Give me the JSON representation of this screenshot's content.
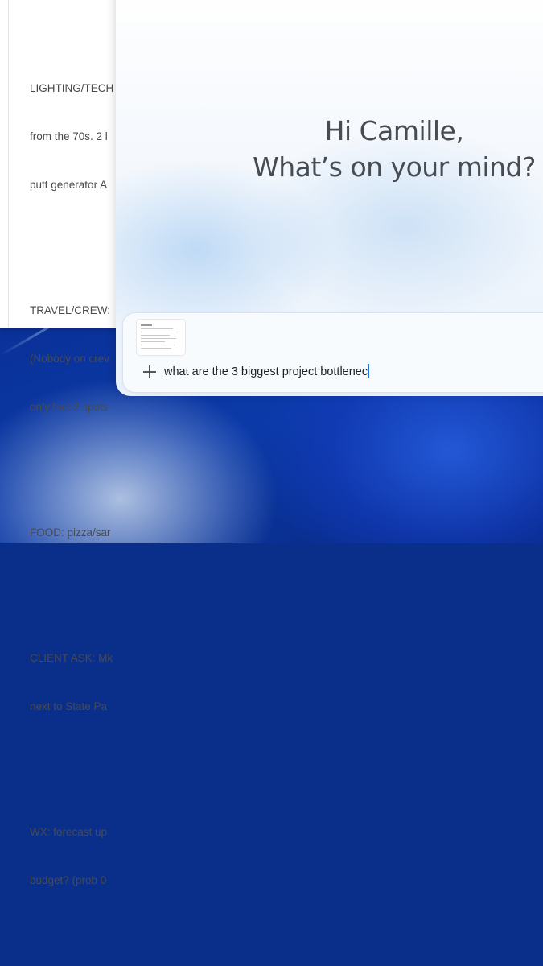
{
  "document": {
    "paragraphs": [
      [
        "LIGHTING/TECH",
        "from the 70s. 2 l",
        "putt generator A"
      ],
      [
        "TRAVEL/CREW:",
        "(Nobody on crev",
        "only has 2 spots"
      ],
      [
        "FOOD: pizza/sar"
      ],
      [
        "CLIENT ASK: Mk",
        "next to State Pa"
      ],
      [
        "WX: forecast up",
        "budget? (prob 0"
      ]
    ]
  },
  "assistant": {
    "greeting_line1": "Hi Camille,",
    "greeting_line2": "What’s on your mind?",
    "query_text": "what are the 3 biggest project bottlenec",
    "add_icon": "plus-icon",
    "attachment": "document-thumbnail"
  },
  "colors": {
    "caret": "#1a73e8",
    "wallpaper": "#0b3aa8"
  }
}
